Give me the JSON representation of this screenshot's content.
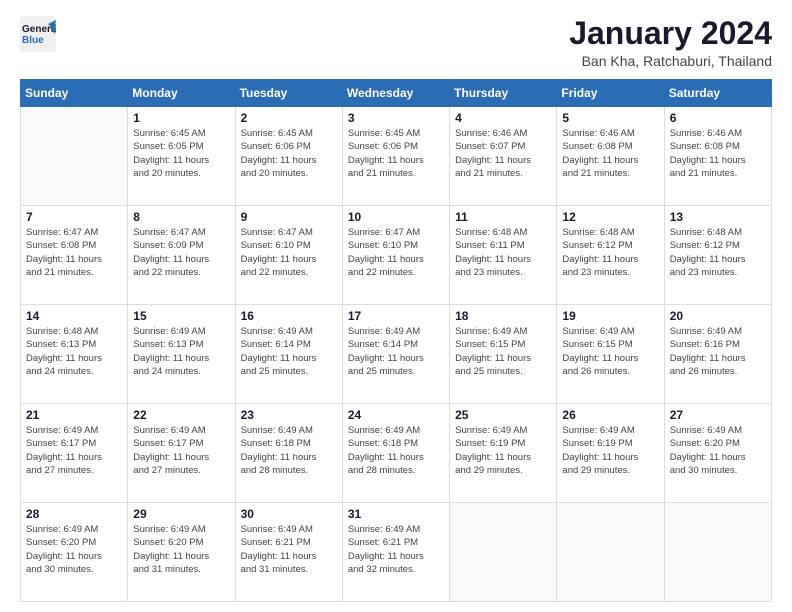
{
  "app": {
    "logo_general": "General",
    "logo_blue": "Blue",
    "title": "January 2024",
    "subtitle": "Ban Kha, Ratchaburi, Thailand"
  },
  "calendar": {
    "headers": [
      "Sunday",
      "Monday",
      "Tuesday",
      "Wednesday",
      "Thursday",
      "Friday",
      "Saturday"
    ],
    "rows": [
      [
        {
          "day": "",
          "info": ""
        },
        {
          "day": "1",
          "info": "Sunrise: 6:45 AM\nSunset: 6:05 PM\nDaylight: 11 hours\nand 20 minutes."
        },
        {
          "day": "2",
          "info": "Sunrise: 6:45 AM\nSunset: 6:06 PM\nDaylight: 11 hours\nand 20 minutes."
        },
        {
          "day": "3",
          "info": "Sunrise: 6:45 AM\nSunset: 6:06 PM\nDaylight: 11 hours\nand 21 minutes."
        },
        {
          "day": "4",
          "info": "Sunrise: 6:46 AM\nSunset: 6:07 PM\nDaylight: 11 hours\nand 21 minutes."
        },
        {
          "day": "5",
          "info": "Sunrise: 6:46 AM\nSunset: 6:08 PM\nDaylight: 11 hours\nand 21 minutes."
        },
        {
          "day": "6",
          "info": "Sunrise: 6:46 AM\nSunset: 6:08 PM\nDaylight: 11 hours\nand 21 minutes."
        }
      ],
      [
        {
          "day": "7",
          "info": "Sunrise: 6:47 AM\nSunset: 6:08 PM\nDaylight: 11 hours\nand 21 minutes."
        },
        {
          "day": "8",
          "info": "Sunrise: 6:47 AM\nSunset: 6:09 PM\nDaylight: 11 hours\nand 22 minutes."
        },
        {
          "day": "9",
          "info": "Sunrise: 6:47 AM\nSunset: 6:10 PM\nDaylight: 11 hours\nand 22 minutes."
        },
        {
          "day": "10",
          "info": "Sunrise: 6:47 AM\nSunset: 6:10 PM\nDaylight: 11 hours\nand 22 minutes."
        },
        {
          "day": "11",
          "info": "Sunrise: 6:48 AM\nSunset: 6:11 PM\nDaylight: 11 hours\nand 23 minutes."
        },
        {
          "day": "12",
          "info": "Sunrise: 6:48 AM\nSunset: 6:12 PM\nDaylight: 11 hours\nand 23 minutes."
        },
        {
          "day": "13",
          "info": "Sunrise: 6:48 AM\nSunset: 6:12 PM\nDaylight: 11 hours\nand 23 minutes."
        }
      ],
      [
        {
          "day": "14",
          "info": "Sunrise: 6:48 AM\nSunset: 6:13 PM\nDaylight: 11 hours\nand 24 minutes."
        },
        {
          "day": "15",
          "info": "Sunrise: 6:49 AM\nSunset: 6:13 PM\nDaylight: 11 hours\nand 24 minutes."
        },
        {
          "day": "16",
          "info": "Sunrise: 6:49 AM\nSunset: 6:14 PM\nDaylight: 11 hours\nand 25 minutes."
        },
        {
          "day": "17",
          "info": "Sunrise: 6:49 AM\nSunset: 6:14 PM\nDaylight: 11 hours\nand 25 minutes."
        },
        {
          "day": "18",
          "info": "Sunrise: 6:49 AM\nSunset: 6:15 PM\nDaylight: 11 hours\nand 25 minutes."
        },
        {
          "day": "19",
          "info": "Sunrise: 6:49 AM\nSunset: 6:15 PM\nDaylight: 11 hours\nand 26 minutes."
        },
        {
          "day": "20",
          "info": "Sunrise: 6:49 AM\nSunset: 6:16 PM\nDaylight: 11 hours\nand 26 minutes."
        }
      ],
      [
        {
          "day": "21",
          "info": "Sunrise: 6:49 AM\nSunset: 6:17 PM\nDaylight: 11 hours\nand 27 minutes."
        },
        {
          "day": "22",
          "info": "Sunrise: 6:49 AM\nSunset: 6:17 PM\nDaylight: 11 hours\nand 27 minutes."
        },
        {
          "day": "23",
          "info": "Sunrise: 6:49 AM\nSunset: 6:18 PM\nDaylight: 11 hours\nand 28 minutes."
        },
        {
          "day": "24",
          "info": "Sunrise: 6:49 AM\nSunset: 6:18 PM\nDaylight: 11 hours\nand 28 minutes."
        },
        {
          "day": "25",
          "info": "Sunrise: 6:49 AM\nSunset: 6:19 PM\nDaylight: 11 hours\nand 29 minutes."
        },
        {
          "day": "26",
          "info": "Sunrise: 6:49 AM\nSunset: 6:19 PM\nDaylight: 11 hours\nand 29 minutes."
        },
        {
          "day": "27",
          "info": "Sunrise: 6:49 AM\nSunset: 6:20 PM\nDaylight: 11 hours\nand 30 minutes."
        }
      ],
      [
        {
          "day": "28",
          "info": "Sunrise: 6:49 AM\nSunset: 6:20 PM\nDaylight: 11 hours\nand 30 minutes."
        },
        {
          "day": "29",
          "info": "Sunrise: 6:49 AM\nSunset: 6:20 PM\nDaylight: 11 hours\nand 31 minutes."
        },
        {
          "day": "30",
          "info": "Sunrise: 6:49 AM\nSunset: 6:21 PM\nDaylight: 11 hours\nand 31 minutes."
        },
        {
          "day": "31",
          "info": "Sunrise: 6:49 AM\nSunset: 6:21 PM\nDaylight: 11 hours\nand 32 minutes."
        },
        {
          "day": "",
          "info": ""
        },
        {
          "day": "",
          "info": ""
        },
        {
          "day": "",
          "info": ""
        }
      ]
    ]
  }
}
